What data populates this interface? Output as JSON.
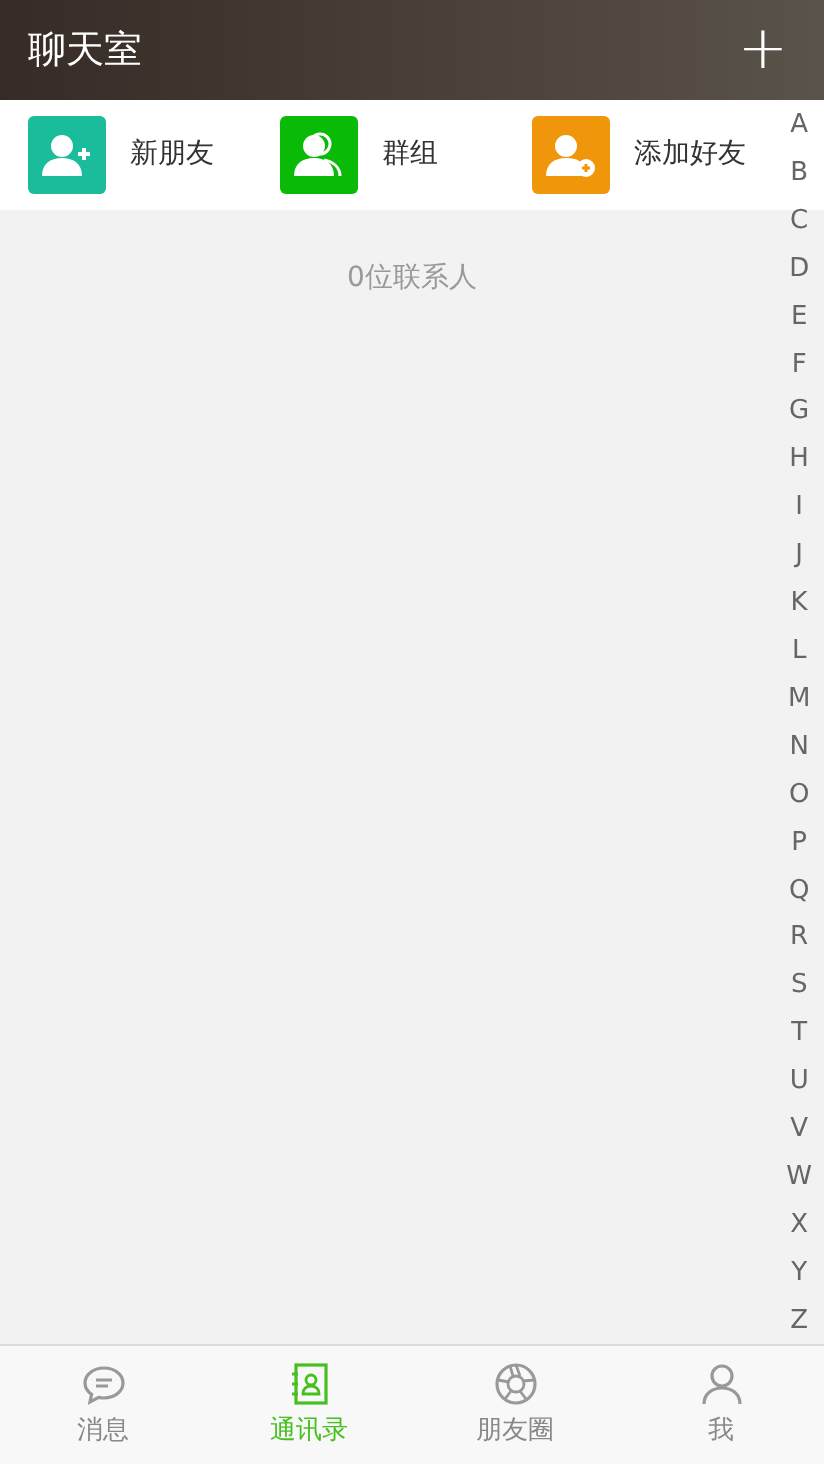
{
  "header": {
    "title": "聊天室",
    "action": "+"
  },
  "shortcuts": [
    {
      "kind": "new-friend",
      "label": "新朋友",
      "color": "#1abc9c"
    },
    {
      "kind": "group",
      "label": "群组",
      "color": "#09bb07"
    },
    {
      "kind": "add-friend",
      "label": "添加好友",
      "color": "#f0960a"
    }
  ],
  "contact_count": "0位联系人",
  "index_letters": [
    "A",
    "B",
    "C",
    "D",
    "E",
    "F",
    "G",
    "H",
    "I",
    "J",
    "K",
    "L",
    "M",
    "N",
    "O",
    "P",
    "Q",
    "R",
    "S",
    "T",
    "U",
    "V",
    "W",
    "X",
    "Y",
    "Z"
  ],
  "tabs": [
    {
      "kind": "chat",
      "label": "消息",
      "selected": false
    },
    {
      "kind": "contacts",
      "label": "通讯录",
      "selected": true
    },
    {
      "kind": "moments",
      "label": "朋友圈",
      "selected": false
    },
    {
      "kind": "me",
      "label": "我",
      "selected": false
    }
  ]
}
